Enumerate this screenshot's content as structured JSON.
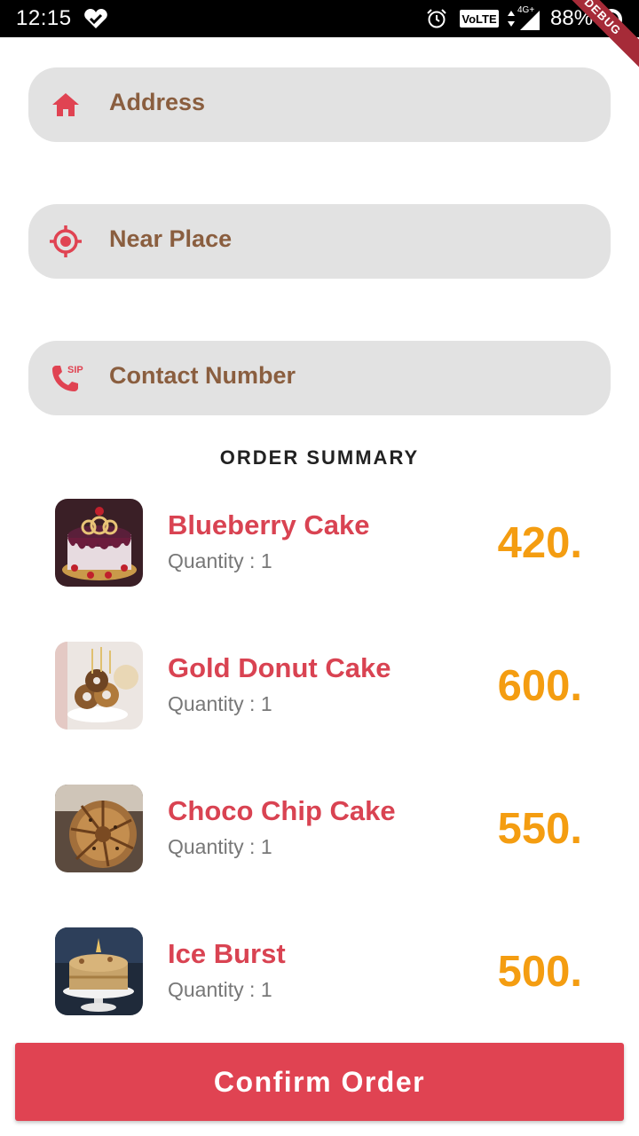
{
  "status_bar": {
    "time": "12:15",
    "volte": "VoLTE",
    "network": "4G+",
    "battery": "88%"
  },
  "debug_banner": "DEBUG",
  "form": {
    "address": {
      "placeholder": "Address",
      "icon": "home-icon"
    },
    "near_place": {
      "placeholder": "Near Place",
      "icon": "location-target-icon"
    },
    "contact": {
      "placeholder": "Contact Number",
      "icon": "sip-phone-icon"
    }
  },
  "order_summary": {
    "title": "ORDER SUMMARY",
    "items": [
      {
        "name": "Blueberry Cake",
        "quantity": "Quantity : 1",
        "price": "420."
      },
      {
        "name": "Gold Donut Cake",
        "quantity": "Quantity : 1",
        "price": "600."
      },
      {
        "name": "Choco Chip Cake",
        "quantity": "Quantity : 1",
        "price": "550."
      },
      {
        "name": "Ice Burst",
        "quantity": "Quantity : 1",
        "price": "500."
      }
    ]
  },
  "confirm_button": "Confirm Order",
  "colors": {
    "accent": "#e04352",
    "label": "#8a5e3f",
    "price": "#f49d11",
    "item_name": "#d94352",
    "field_bg": "#e2e2e2"
  }
}
